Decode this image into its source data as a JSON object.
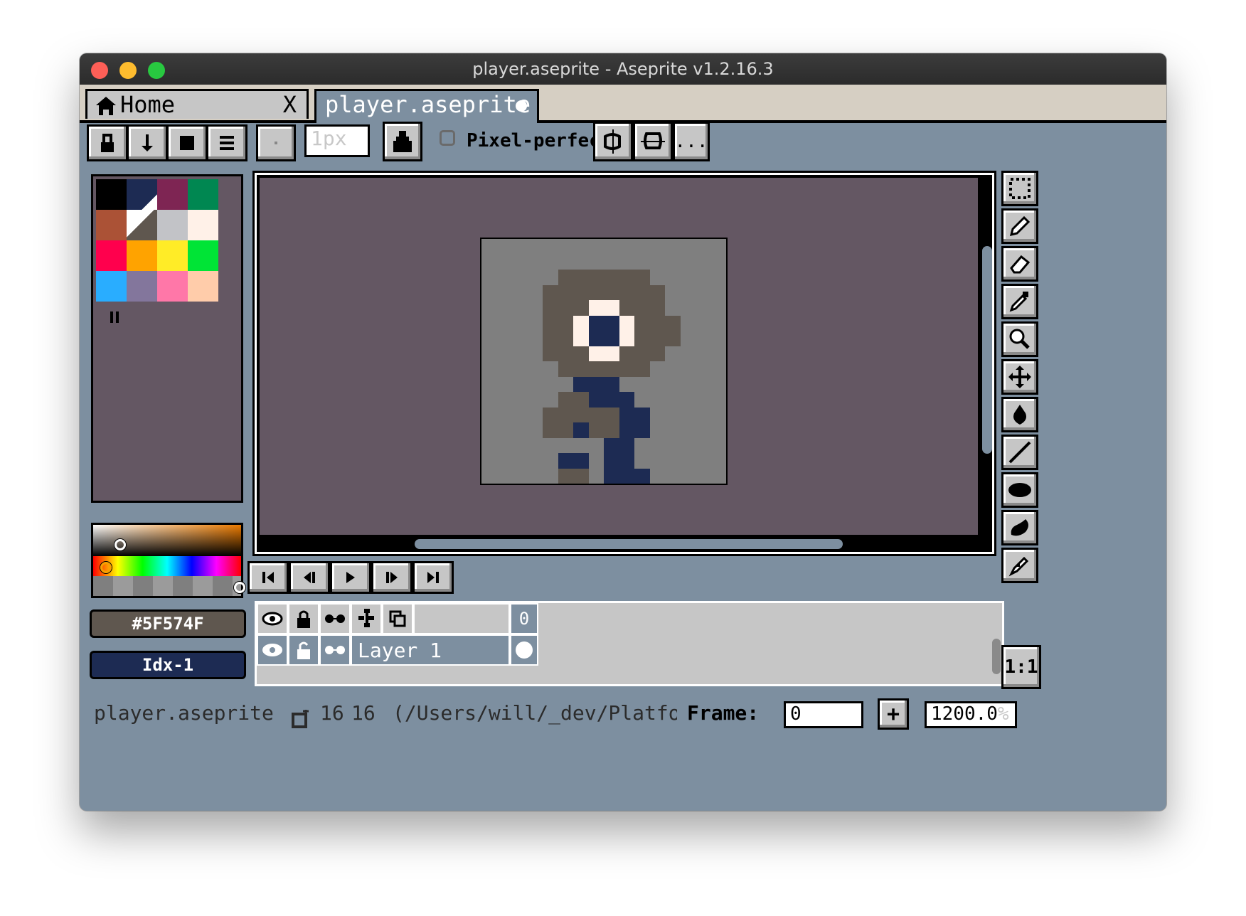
{
  "window": {
    "title": "player.aseprite - Aseprite v1.2.16.3"
  },
  "tabs": [
    {
      "label": "Home",
      "close": "X"
    },
    {
      "label": "player.aseprite"
    }
  ],
  "toolbar": {
    "brush_size_placeholder": "1px",
    "pixel_perfect_label": "Pixel-perfect",
    "more_label": "..."
  },
  "palette": {
    "colors": [
      "#000000",
      "#1d2b53",
      "#7e2553",
      "#008751",
      "#ab5236",
      "#5f574f",
      "#c2c3c7",
      "#fff1e8",
      "#ff004d",
      "#ffa300",
      "#ffec27",
      "#00e436",
      "#29adff",
      "#83769c",
      "#ff77a8",
      "#ffccaa"
    ]
  },
  "color_bar": {
    "foreground_hex": "#5F574F",
    "foreground_color": "#5f574f",
    "background_label": "Idx-1",
    "background_color": "#1d2b53"
  },
  "timeline": {
    "frame_header": "0",
    "layer_name": "Layer 1"
  },
  "status": {
    "filename": "player.aseprite",
    "width": "16",
    "height": "16",
    "path": "(/Users/will/_dev/Platformer/",
    "frame_label": "Frame:",
    "frame_value": "0",
    "add_frame": "+",
    "zoom_value": "1200.0",
    "zoom_unit": "%"
  },
  "zoom_reset_label": "1:1",
  "accent_colors": {
    "ui_blue": "#7d8fa0",
    "canvas_bg": "#645763",
    "button_gray": "#c6c6c6"
  }
}
